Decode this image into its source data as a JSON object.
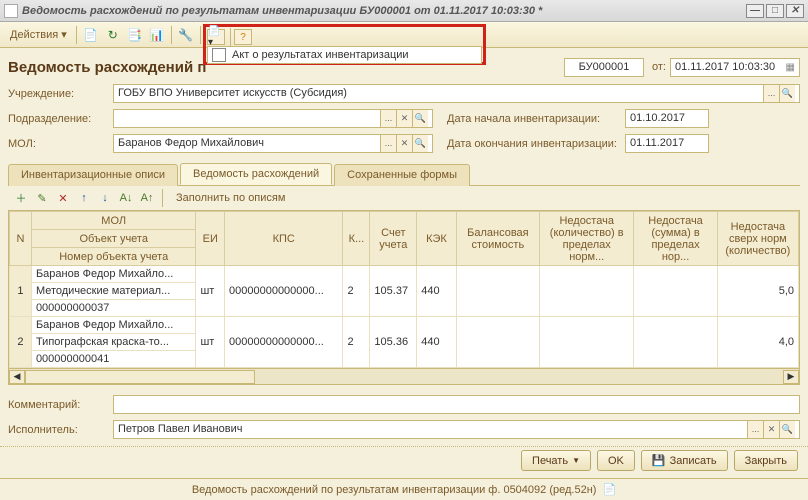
{
  "window": {
    "title": "Ведомость расхождений по результатам инвентаризации БУ000001 от 01.11.2017 10:03:30 *"
  },
  "toolbar": {
    "actions_label": "Действия ▾"
  },
  "popup": {
    "menu_item": "Акт о результатах инвентаризации"
  },
  "header": {
    "title_prefix": "Ведомость расхождений п",
    "number": "БУ000001",
    "ot": "от:",
    "date": "01.11.2017 10:03:30"
  },
  "form": {
    "org_lbl": "Учреждение:",
    "org_val": "ГОБУ ВПО Университет искусств (Субсидия)",
    "dept_lbl": "Подразделение:",
    "dept_val": "",
    "mol_lbl": "МОЛ:",
    "mol_val": "Баранов Федор Михайлович",
    "dstart_lbl": "Дата начала инвентаризации:",
    "dstart_val": "01.10.2017",
    "dend_lbl": "Дата окончания инвентаризации:",
    "dend_val": "01.11.2017"
  },
  "tabs": {
    "t1": "Инвентаризационные описи",
    "t2": "Ведомость расхождений",
    "t3": "Сохраненные формы"
  },
  "gridtb": {
    "fill": "Заполнить по описям"
  },
  "cols": {
    "n": "N",
    "mol": "МОЛ",
    "obj": "Объект учета",
    "nobj": "Номер объекта учета",
    "ei": "ЕИ",
    "kps": "КПС",
    "k": "К...",
    "acc": "Счет учета",
    "kek": "КЭК",
    "bal": "Балансовая стоимость",
    "nq": "Недостача (количество) в пределах норм...",
    "ns": "Недостача (сумма) в пределах нор...",
    "nsq": "Недостача сверх норм (количество)"
  },
  "rows": [
    {
      "n": "1",
      "mol": "Баранов Федор Михайло...",
      "obj": "Методические материал...",
      "nobj": "000000000037",
      "ei": "шт",
      "kps": "00000000000000...",
      "k": "2",
      "acc": "105.37",
      "kek": "440",
      "bal": "",
      "nq": "",
      "ns": "",
      "nsq": "5,0"
    },
    {
      "n": "2",
      "mol": "Баранов Федор Михайло...",
      "obj": "Типографская краска-то...",
      "nobj": "000000000041",
      "ei": "шт",
      "kps": "00000000000000...",
      "k": "2",
      "acc": "105.36",
      "kek": "440",
      "bal": "",
      "nq": "",
      "ns": "",
      "nsq": "4,0"
    }
  ],
  "bottom": {
    "comment_lbl": "Комментарий:",
    "comment_val": "",
    "exec_lbl": "Исполнитель:",
    "exec_val": "Петров Павел Иванович"
  },
  "footer": {
    "print": "Печать",
    "ok": "OK",
    "save": "Записать",
    "close": "Закрыть"
  },
  "status": "Ведомость расхождений по результатам инвентаризации ф. 0504092 (ред.52н)"
}
